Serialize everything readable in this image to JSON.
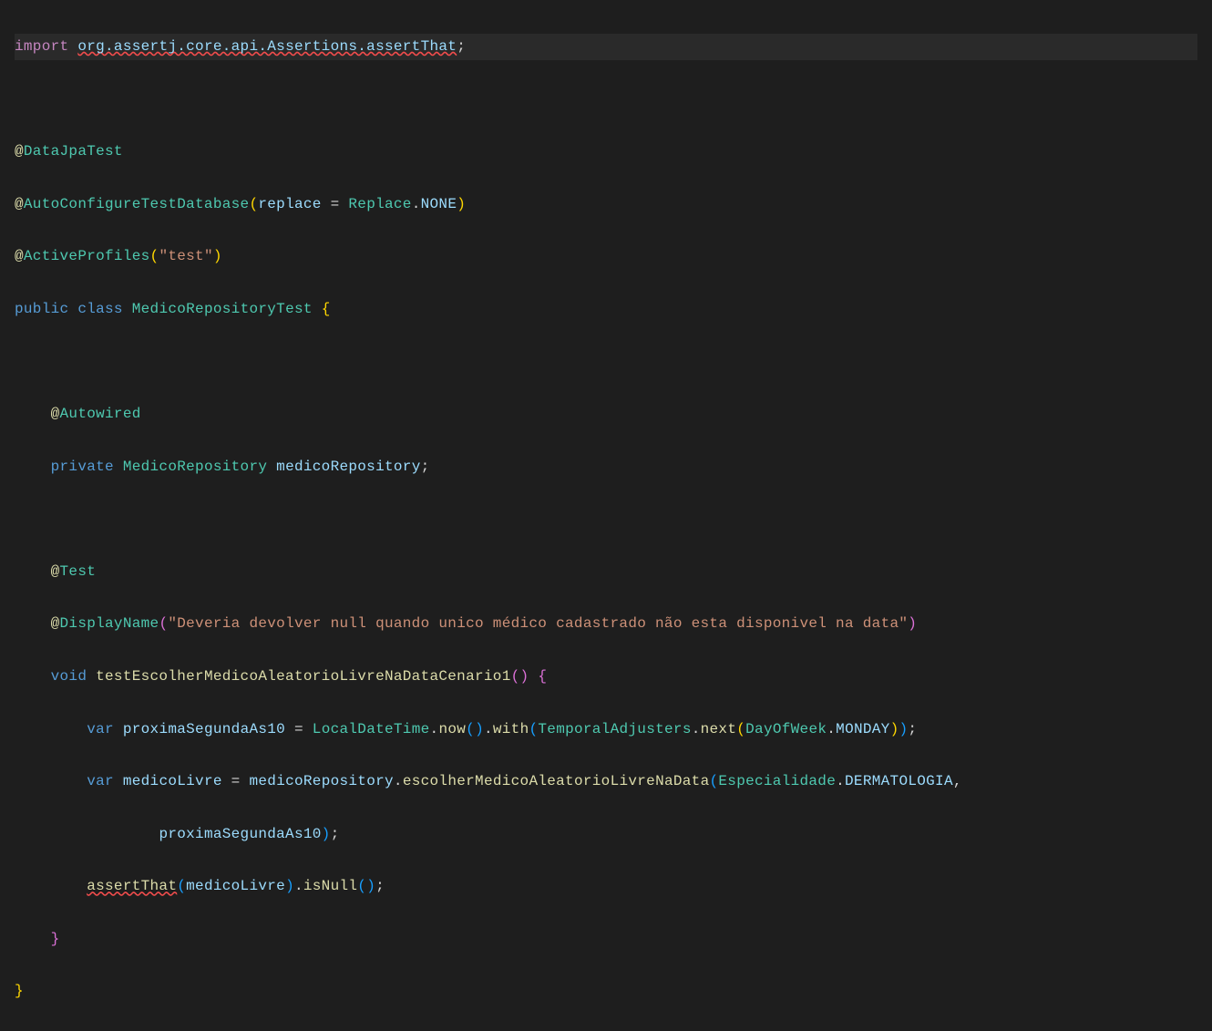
{
  "code": {
    "line1": {
      "import": "import",
      "package": "org.assertj.core.api.Assertions.assertThat",
      "semi": ";"
    },
    "line3": {
      "at": "@",
      "annotation": "DataJpaTest"
    },
    "line4": {
      "at": "@",
      "annotation": "AutoConfigureTestDatabase",
      "lparen": "(",
      "param": "replace",
      "eq": " = ",
      "enumType": "Replace",
      "dot": ".",
      "enumValue": "NONE",
      "rparen": ")"
    },
    "line5": {
      "at": "@",
      "annotation": "ActiveProfiles",
      "lparen": "(",
      "value": "\"test\"",
      "rparen": ")"
    },
    "line6": {
      "public": "public",
      "class": "class",
      "className": "MedicoRepositoryTest",
      "lbrace": "{"
    },
    "line8": {
      "at": "@",
      "annotation": "Autowired"
    },
    "line9": {
      "private": "private",
      "type": "MedicoRepository",
      "name": "medicoRepository",
      "semi": ";"
    },
    "line11": {
      "at": "@",
      "annotation": "Test"
    },
    "line12": {
      "at": "@",
      "annotation": "DisplayName",
      "lparen": "(",
      "value": "\"Deveria devolver null quando unico médico cadastrado não esta disponivel na data\"",
      "rparen": ")"
    },
    "line13": {
      "void": "void",
      "methodName": "testEscolherMedicoAleatorioLivreNaDataCenario1",
      "lparen": "(",
      "rparen": ")",
      "lbrace": "{"
    },
    "line14": {
      "var": "var",
      "varName": "proximaSegundaAs10",
      "eq": " = ",
      "type1": "LocalDateTime",
      "dot1": ".",
      "method1": "now",
      "lp1": "(",
      "rp1": ")",
      "dot2": ".",
      "method2": "with",
      "lp2": "(",
      "type2": "TemporalAdjusters",
      "dot3": ".",
      "method3": "next",
      "lp3": "(",
      "type3": "DayOfWeek",
      "dot4": ".",
      "enum1": "MONDAY",
      "rp3": ")",
      "rp2": ")",
      "semi": ";"
    },
    "line15": {
      "var": "var",
      "varName": "medicoLivre",
      "eq": " = ",
      "obj": "medicoRepository",
      "dot1": ".",
      "method1": "escolherMedicoAleatorioLivreNaData",
      "lp1": "(",
      "type1": "Especialidade",
      "dot2": ".",
      "enum1": "DERMATOLOGIA",
      "comma": ","
    },
    "line16": {
      "arg": "proximaSegundaAs10",
      "rp1": ")",
      "semi": ";"
    },
    "line17": {
      "method1": "assertThat",
      "lp1": "(",
      "arg1": "medicoLivre",
      "rp1": ")",
      "dot1": ".",
      "method2": "isNull",
      "lp2": "(",
      "rp2": ")",
      "semi": ";"
    },
    "line18": {
      "rbrace": "}"
    },
    "line19": {
      "rbrace": "}"
    }
  }
}
